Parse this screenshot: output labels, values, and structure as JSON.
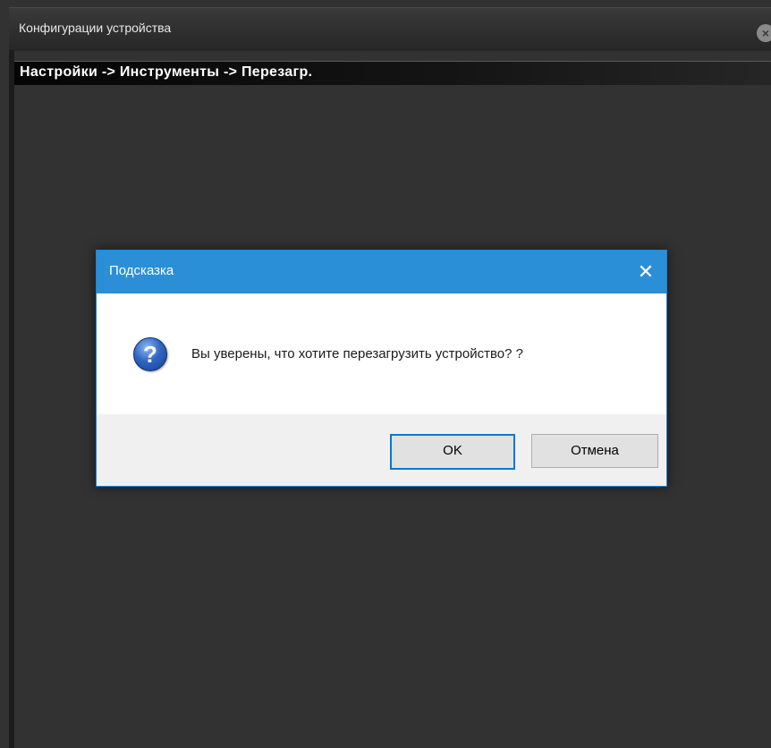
{
  "window": {
    "title": "Конфигурации устройства",
    "close_glyph": "×"
  },
  "breadcrumb": {
    "text": "Настройки -> Инструменты -> Перезагр."
  },
  "dialog": {
    "title": "Подсказка",
    "close_glyph": "✕",
    "icon": "question-icon",
    "icon_glyph": "?",
    "message": "Вы уверены, что хотите перезагрузить устройство? ?",
    "ok_label": "OK",
    "cancel_label": "Отмена"
  },
  "colors": {
    "dialog_titlebar": "#2b8fd8",
    "window_background": "#323232",
    "default_button_border": "#0078d7"
  }
}
